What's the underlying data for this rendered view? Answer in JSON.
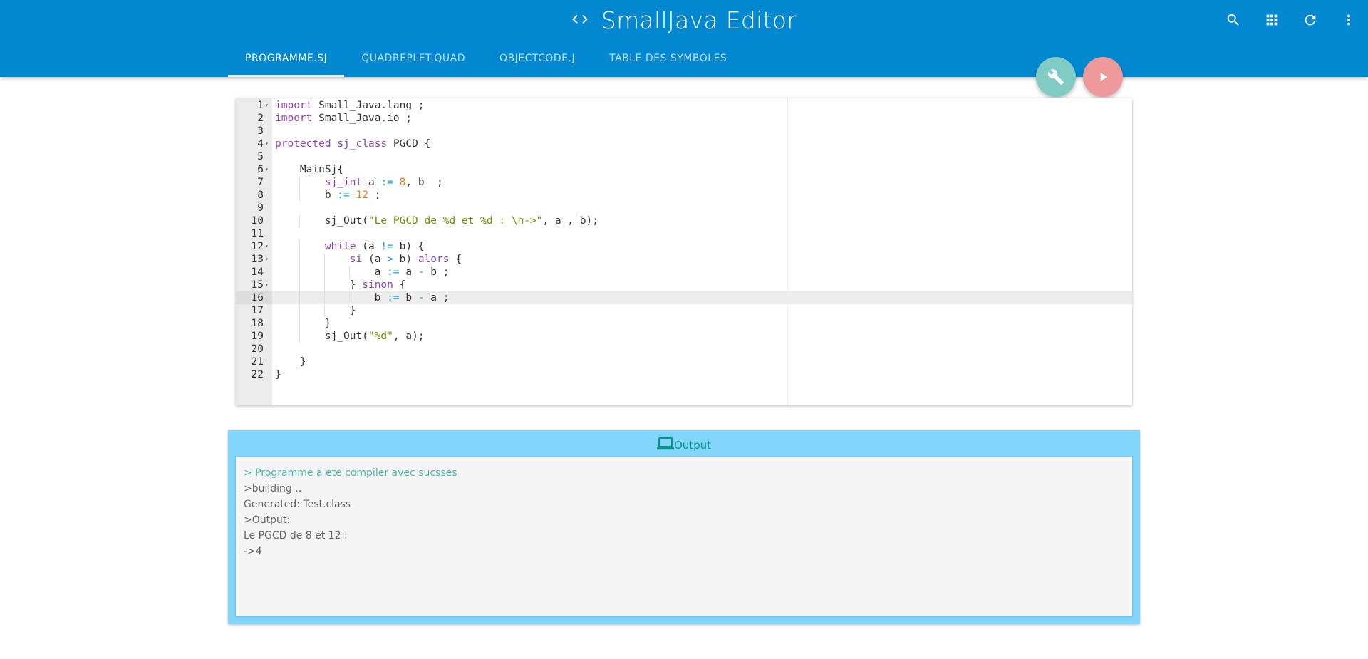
{
  "app": {
    "title": "SmallJava Editor"
  },
  "header": {
    "icons": [
      "search-icon",
      "apps-icon",
      "refresh-icon",
      "more-vert-icon"
    ]
  },
  "tabs": [
    {
      "label": "PROGRAMME.SJ",
      "active": true
    },
    {
      "label": "QUADREPLET.QUAD",
      "active": false
    },
    {
      "label": "OBJECTCODE.J",
      "active": false
    },
    {
      "label": "TABLE DES SYMBOLES",
      "active": false
    }
  ],
  "fabs": {
    "build_icon": "wrench-icon",
    "run_icon": "play-icon"
  },
  "colors": {
    "primary": "#0288d1",
    "build_fab": "#80cbc4",
    "run_fab": "#ef9a9a",
    "output_panel": "#81d4fa",
    "success_text": "#4db6ac"
  },
  "editor": {
    "active_line": 16,
    "lines": [
      "import Small_Java.lang ;",
      "import Small_Java.io ;",
      "",
      "protected sj_class PGCD {",
      "",
      "    MainSj{",
      "        sj_int a := 8, b  ;",
      "        b := 12 ;",
      "",
      "        sj_Out(\"Le PGCD de %d et %d : \\n->\", a , b);",
      "",
      "        while (a != b) {",
      "            si (a > b) alors {",
      "                a := a - b ;",
      "            } sinon {",
      "                b := b - a ;",
      "            }",
      "        }",
      "        sj_Out(\"%d\", a);",
      "",
      "    }",
      "}"
    ]
  },
  "output": {
    "title": "Output",
    "icon": "laptop-icon",
    "lines": [
      {
        "text": "> Programme a ete compiler avec sucsses",
        "status": "success"
      },
      {
        "text": ">building ..",
        "status": "normal"
      },
      {
        "text": "Generated: Test.class",
        "status": "normal"
      },
      {
        "text": ">Output:",
        "status": "normal"
      },
      {
        "text": "Le PGCD de 8 et 12 :",
        "status": "normal"
      },
      {
        "text": "->4",
        "status": "normal"
      }
    ]
  }
}
